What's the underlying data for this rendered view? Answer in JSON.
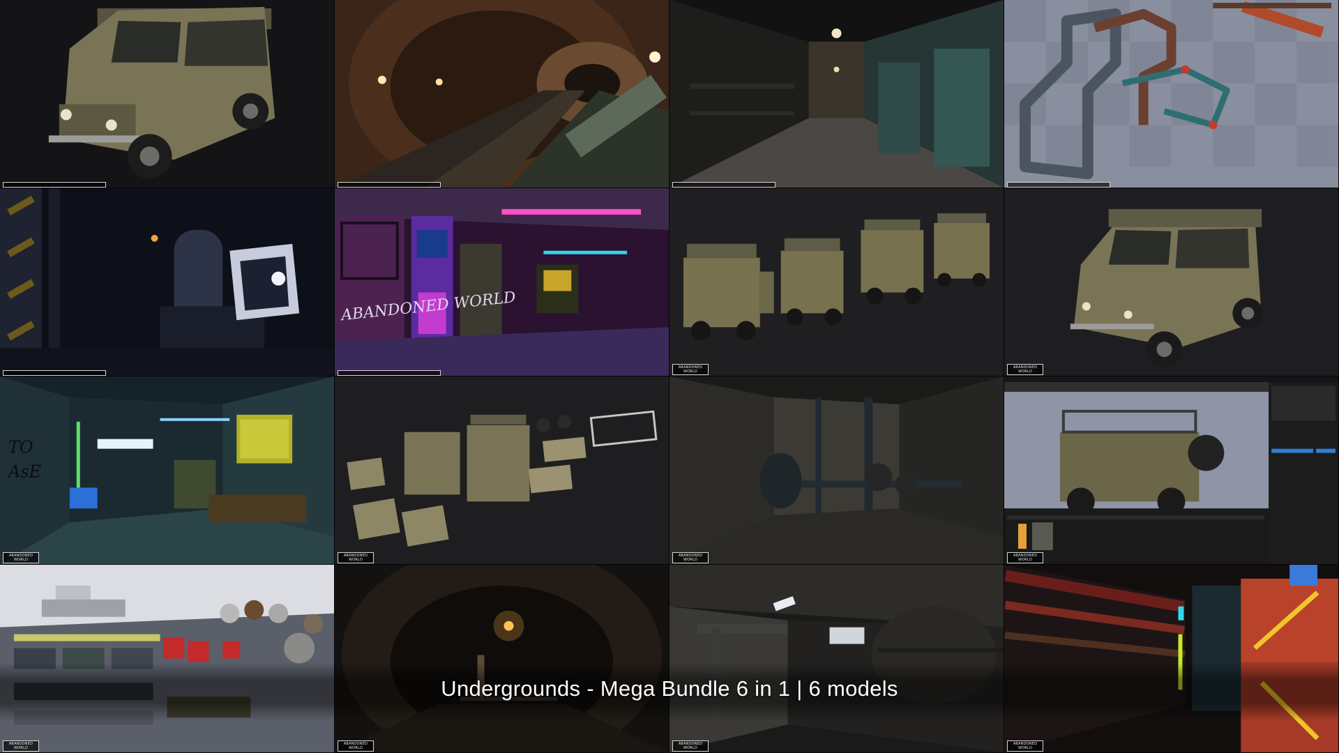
{
  "caption": "Undergrounds - Mega Bundle 6 in 1 | 6 models",
  "watermark": "ABANDONED WORLD",
  "graffiti": "ABANDONED WORLD",
  "tiles": [
    {
      "name": "tile-uaz-jeep-hero-render",
      "icon": "jeep-icon"
    },
    {
      "name": "tile-metro-tunnel-rails",
      "icon": "tunnel-icon"
    },
    {
      "name": "tile-corridor-metal-doors",
      "icon": "corridor-icon"
    },
    {
      "name": "tile-pipe-kit-viewport",
      "icon": "pipes-icon"
    },
    {
      "name": "tile-dark-boiler-room",
      "icon": "boiler-icon"
    },
    {
      "name": "tile-neon-arcade-room",
      "icon": "arcade-icon"
    },
    {
      "name": "tile-jeep-variants-lineup",
      "icon": "jeep-icon"
    },
    {
      "name": "tile-uaz-jeep-render-2",
      "icon": "jeep-icon"
    },
    {
      "name": "tile-graffiti-passage",
      "icon": "corridor-icon"
    },
    {
      "name": "tile-jeep-exploded-parts",
      "icon": "jeep-icon"
    },
    {
      "name": "tile-pump-room-pipes",
      "icon": "pipes-icon"
    },
    {
      "name": "tile-unreal-editor-jeep",
      "icon": "editor-icon"
    },
    {
      "name": "tile-props-asset-overview",
      "icon": "props-icon"
    },
    {
      "name": "tile-dark-tunnel-lamp",
      "icon": "tunnel-icon"
    },
    {
      "name": "tile-tunnel-service-pipes",
      "icon": "pipes-icon"
    },
    {
      "name": "tile-neon-crates-corridor",
      "icon": "crate-icon"
    }
  ],
  "colors": {
    "jeep": "#7d7656",
    "neon_pink": "#c23cd6",
    "neon_cyan": "#34d6e8",
    "neon_yellow": "#f2c42a",
    "viewport_floor": "#7f8493"
  }
}
